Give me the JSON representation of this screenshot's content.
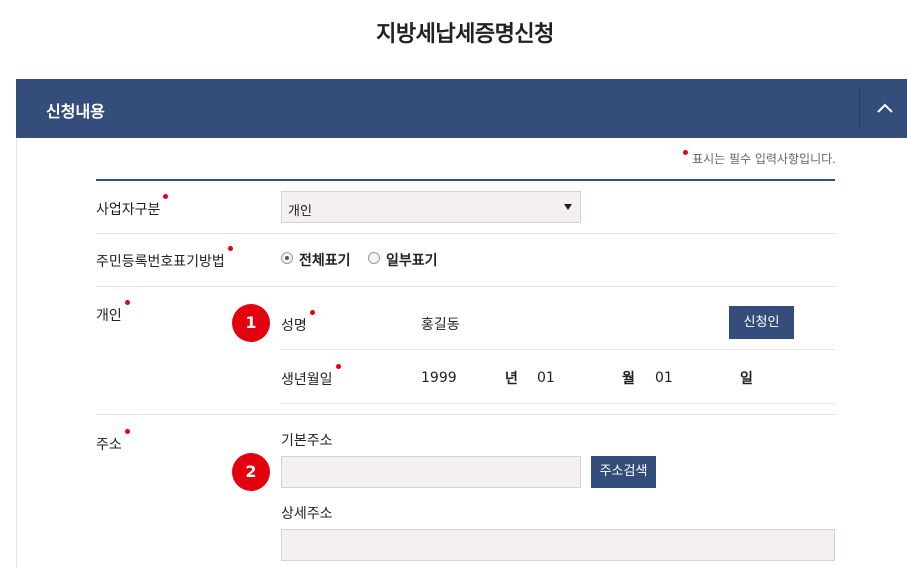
{
  "page": {
    "title": "지방세납세증명신청"
  },
  "section": {
    "title": "신청내용"
  },
  "required_note": "표시는 필수 입력사항입니다.",
  "applicant_type": {
    "label": "사업자구분",
    "value": "개인"
  },
  "id_display": {
    "label": "주민등록번호표기방법",
    "options": [
      "전체표기",
      "일부표기"
    ],
    "selected": "전체표기"
  },
  "individual": {
    "label": "개인",
    "badge": "1",
    "name_label": "성명",
    "name_value": "홍길동",
    "applicant_button": "신청인",
    "birth_label": "생년월일",
    "year": "1999",
    "year_unit": "년",
    "month": "01",
    "month_unit": "월",
    "day": "01",
    "day_unit": "일"
  },
  "address": {
    "label": "주소",
    "badge": "2",
    "base_label": "기본주소",
    "base_value": "",
    "search_button": "주소검색",
    "detail_label": "상세주소",
    "detail_value": ""
  },
  "colors": {
    "navy": "#344d7a",
    "required_red": "#e60012",
    "badge_red": "#e3000f",
    "input_bg": "#f4f0f0"
  },
  "icons": {
    "collapse": "chevron-up-icon",
    "select": "caret-down-icon"
  }
}
